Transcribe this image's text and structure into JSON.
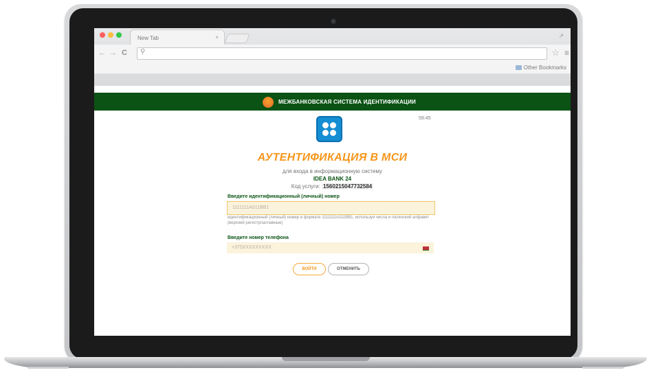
{
  "browser": {
    "tab_title": "New Tab",
    "tab_close": "×",
    "nav_back": "←",
    "nav_forward": "→",
    "nav_reload": "C",
    "search_glyph": "⚲",
    "star": "☆",
    "menu": "≡",
    "bookmarks_other": "Other Bookmarks",
    "resize": "↗"
  },
  "page": {
    "system_title": "МЕЖБАНКОВСКАЯ СИСТЕМА ИДЕНТИФИКАЦИИ",
    "time": "59:45",
    "heading": "АУТЕНТИФИКАЦИЯ В МСИ",
    "subtitle": "для входа в информационную систему",
    "bank_name": "IDEA BANK 24",
    "service_code_label": "Код услуги:",
    "service_code_value": "1560215047732584",
    "id_label": "Введите идентификационный (личный) номер",
    "id_value": "1111111A011BB1",
    "id_hint": "идентификационный (личный) номер в формате 1111111A111BB1, используя числа и латинский алфавит (верхний регистр/заглавные)",
    "phone_label": "Введите номер телефона",
    "phone_placeholder": "+375XXXXXXXXX",
    "login_button": "ВОЙТИ",
    "cancel_button": "ОТМЕНИТЬ"
  },
  "colors": {
    "brand_green": "#0b5314",
    "accent_orange": "#f6961b",
    "icon_blue": "#168ed3"
  }
}
